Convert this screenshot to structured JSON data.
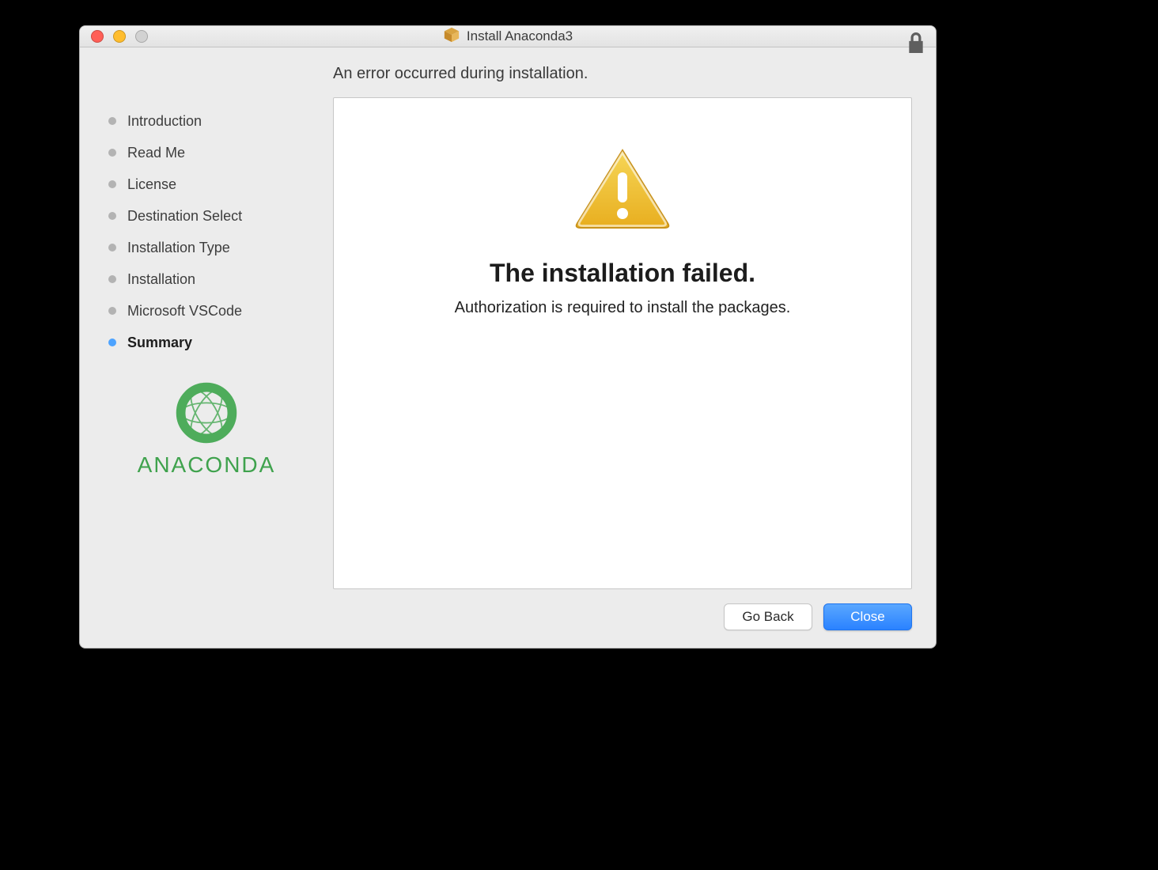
{
  "window": {
    "title": "Install Anaconda3"
  },
  "icons": {
    "package": "package-icon",
    "lock": "lock-icon",
    "warning": "warning-triangle-icon"
  },
  "heading": "An error occurred during installation.",
  "sidebar": {
    "steps": [
      {
        "label": "Introduction",
        "active": false
      },
      {
        "label": "Read Me",
        "active": false
      },
      {
        "label": "License",
        "active": false
      },
      {
        "label": "Destination Select",
        "active": false
      },
      {
        "label": "Installation Type",
        "active": false
      },
      {
        "label": "Installation",
        "active": false
      },
      {
        "label": "Microsoft VSCode",
        "active": false
      },
      {
        "label": "Summary",
        "active": true
      }
    ],
    "brand": "ANACONDA"
  },
  "content": {
    "failure_title": "The installation failed.",
    "failure_message": "Authorization is required to install the packages."
  },
  "buttons": {
    "go_back": "Go Back",
    "close": "Close"
  },
  "colors": {
    "primary_blue": "#2a82ff",
    "anaconda_green": "#4eac5b",
    "warning_yellow": "#efbf2e"
  }
}
